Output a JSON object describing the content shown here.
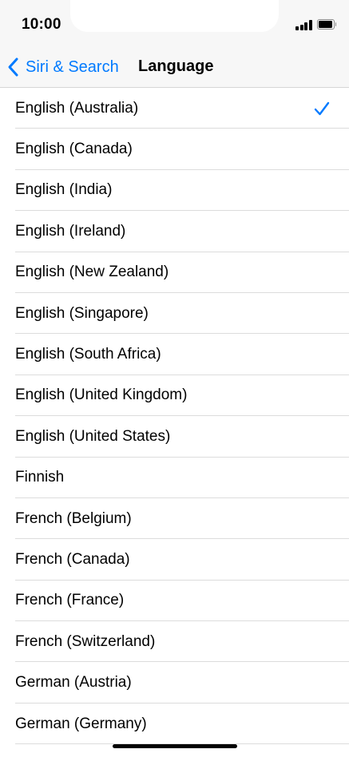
{
  "status_bar": {
    "time": "10:00"
  },
  "nav": {
    "back_label": "Siri & Search",
    "title": "Language"
  },
  "languages": [
    {
      "label": "English (Australia)",
      "selected": true
    },
    {
      "label": "English (Canada)",
      "selected": false
    },
    {
      "label": "English (India)",
      "selected": false
    },
    {
      "label": "English (Ireland)",
      "selected": false
    },
    {
      "label": "English (New Zealand)",
      "selected": false
    },
    {
      "label": "English (Singapore)",
      "selected": false
    },
    {
      "label": "English (South Africa)",
      "selected": false
    },
    {
      "label": "English (United Kingdom)",
      "selected": false
    },
    {
      "label": "English (United States)",
      "selected": false
    },
    {
      "label": "Finnish",
      "selected": false
    },
    {
      "label": "French (Belgium)",
      "selected": false
    },
    {
      "label": "French (Canada)",
      "selected": false
    },
    {
      "label": "French (France)",
      "selected": false
    },
    {
      "label": "French (Switzerland)",
      "selected": false
    },
    {
      "label": "German (Austria)",
      "selected": false
    },
    {
      "label": "German (Germany)",
      "selected": false
    }
  ],
  "colors": {
    "accent": "#007aff",
    "nav_background": "#f7f7f7",
    "separator": "#dcdcdc"
  },
  "icons": {
    "back": "chevron-left-icon",
    "selected": "checkmark-icon",
    "signal": "cellular-signal-icon",
    "battery": "battery-icon"
  }
}
